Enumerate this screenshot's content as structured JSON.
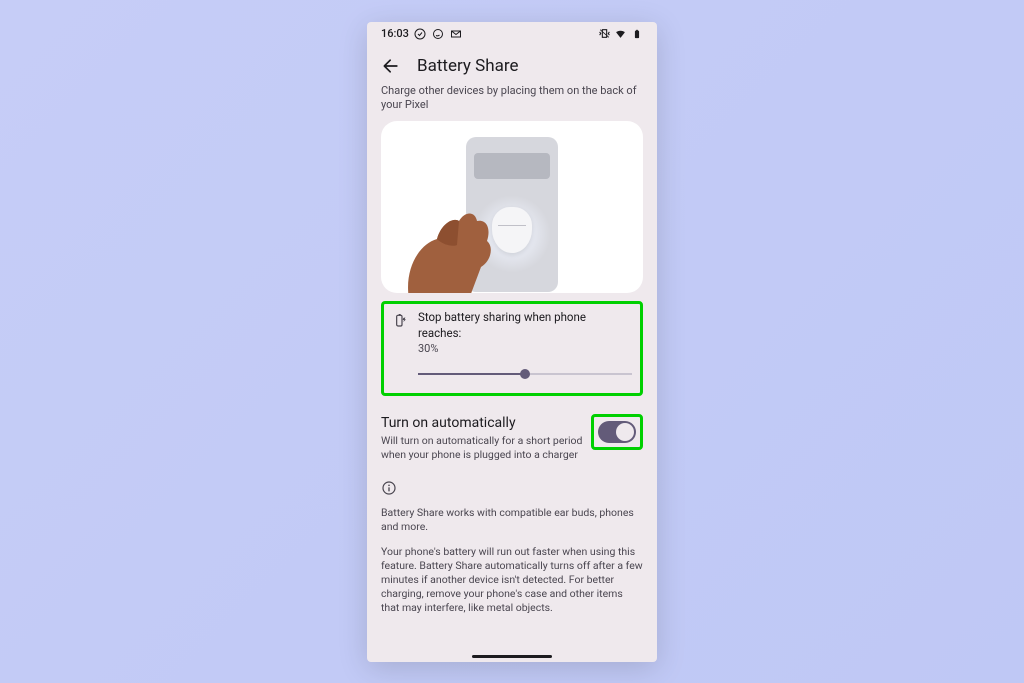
{
  "status": {
    "time": "16:03",
    "icons_left": [
      "check-circle-icon",
      "whatsapp-icon",
      "gmail-icon"
    ],
    "icons_right": [
      "vibrate-icon",
      "wifi-icon",
      "battery-icon"
    ]
  },
  "header": {
    "title": "Battery Share"
  },
  "description": "Charge other devices by placing them on the back of your Pixel",
  "slider": {
    "label": "Stop battery sharing when phone reaches:",
    "value": "30%",
    "percent": 50
  },
  "auto": {
    "title": "Turn on automatically",
    "subtitle": "Will turn on automatically for a short period when your phone is plugged into a charger",
    "enabled": true
  },
  "info": {
    "p1": "Battery Share works with compatible ear buds, phones and more.",
    "p2": "Your phone's battery will run out faster when using this feature. Battery Share automatically turns off after a few minutes if another device isn't detected. For better charging, remove your phone's case and other items that may interfere, like metal objects."
  },
  "highlights": {
    "slider_section": "#00d000",
    "toggle": "#00d000"
  }
}
